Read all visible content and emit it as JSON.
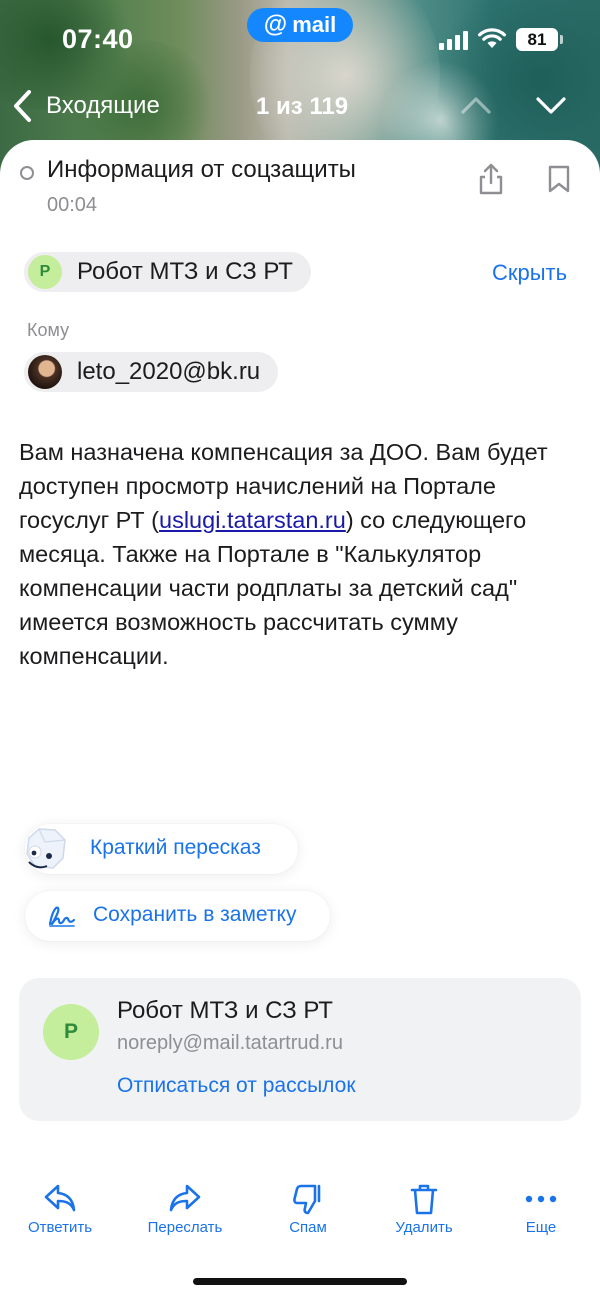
{
  "status_bar": {
    "time": "07:40",
    "battery": "81",
    "app_badge": "mail",
    "app_badge_icon": "@"
  },
  "nav": {
    "back_label": "Входящие",
    "counter": "1 из 119"
  },
  "message": {
    "subject": "Информация от соцзащиты",
    "time": "00:04",
    "sender": {
      "initial": "Р",
      "name": "Робот МТЗ и СЗ РТ"
    },
    "hide_label": "Скрыть",
    "to_label": "Кому",
    "recipient": "leto_2020@bk.ru",
    "body_before_link": "Вам назначена компенсация за ДОО. Вам будет доступен просмотр начислений на Портале госуслуг РТ (",
    "body_link": "uslugi.tatarstan.ru",
    "body_after_link": ") со следующего месяца. Также на Портале в \"Калькулятор компенсации части родплаты за детский сад\" имеется возможность рассчитать сумму компенсации."
  },
  "quick_actions": {
    "summary": "Краткий пересказ",
    "save_note": "Сохранить в заметку"
  },
  "sender_card": {
    "initial": "Р",
    "name": "Робот МТЗ и СЗ РТ",
    "email": "noreply@mail.tatartrud.ru",
    "unsubscribe": "Отписаться от рассылок"
  },
  "toolbar": {
    "reply": "Ответить",
    "forward": "Переслать",
    "spam": "Спам",
    "delete": "Удалить",
    "more": "Еще"
  },
  "colors": {
    "accent": "#1a73e8",
    "mail_badge": "#1487ff",
    "avatar_bg": "#c4ee9b",
    "avatar_fg": "#2f8a39",
    "card_bg": "#f1f2f4"
  }
}
